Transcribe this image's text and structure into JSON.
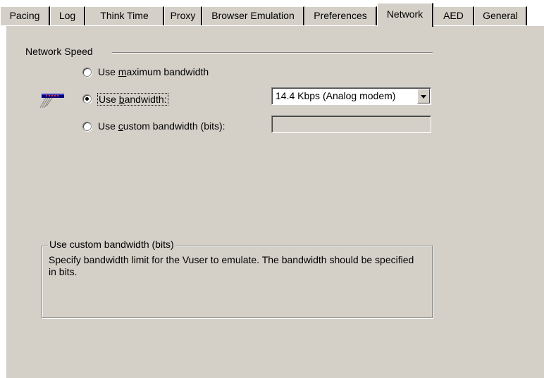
{
  "tabs": [
    {
      "label": "Pacing"
    },
    {
      "label": "Log"
    },
    {
      "label": "Think Time"
    },
    {
      "label": "Proxy"
    },
    {
      "label": "Browser Emulation"
    },
    {
      "label": "Preferences"
    },
    {
      "label": "Network"
    },
    {
      "label": "AED"
    },
    {
      "label": "General"
    }
  ],
  "active_tab": "Network",
  "network_speed": {
    "group_label": "Network Speed",
    "options": [
      {
        "pre": "Use ",
        "mnemonic": "m",
        "post": "aximum bandwidth",
        "selected": false
      },
      {
        "pre": "Use ",
        "mnemonic": "b",
        "post": "andwidth:",
        "selected": true
      },
      {
        "pre": "Use ",
        "mnemonic": "c",
        "post": "ustom bandwidth (bits):",
        "selected": false
      }
    ],
    "bandwidth_select_value": "14.4 Kbps (Analog modem)",
    "custom_bandwidth_value": "",
    "icon": "network-card-icon"
  },
  "help_box": {
    "title": "Use custom bandwidth (bits)",
    "text": "Specify bandwidth limit for the Vuser to emulate. The bandwidth should be specified in bits."
  },
  "colors": {
    "face": "#d4d0c8",
    "shadow": "#808080",
    "highlight": "#ffffff"
  }
}
